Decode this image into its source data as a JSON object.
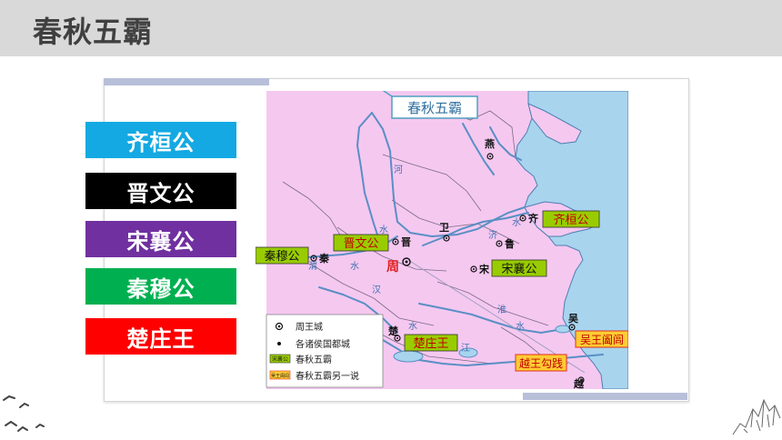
{
  "page_title": "春秋五霸",
  "hegemons": [
    {
      "label": "齐桓公",
      "color": "#14a9e2"
    },
    {
      "label": "晋文公",
      "color": "#000000"
    },
    {
      "label": "宋襄公",
      "color": "#7030a0"
    },
    {
      "label": "秦穆公",
      "color": "#00b050"
    },
    {
      "label": "楚庄王",
      "color": "#ff0000"
    }
  ],
  "map": {
    "title": "春秋五霸",
    "cities": {
      "yan": "燕",
      "qi": "齐",
      "lu": "鲁",
      "song": "宋",
      "wei": "卫",
      "jin": "晋",
      "qin": "秦",
      "zhou": "周",
      "chu": "楚",
      "wu": "吴",
      "yue": "越"
    },
    "hegemon_labels": {
      "qi": "齐桓公",
      "jin": "晋文公",
      "song": "宋襄公",
      "qin": "秦穆公",
      "chu": "楚庄王",
      "wu": "吴王阖闾",
      "yue": "越王勾践"
    },
    "rivers": {
      "he": "河",
      "shui1": "水",
      "ji": "济",
      "shui2": "水",
      "wei": "渭",
      "shui3": "水",
      "han": "汉",
      "shui4": "水",
      "huai": "淮",
      "shui5": "水",
      "jiang": "江"
    },
    "legend": [
      {
        "symbol": "capital-icon",
        "label": "周王城"
      },
      {
        "symbol": "city-icon",
        "label": "各诸侯国都城"
      },
      {
        "symbol": "hegemon-swatch",
        "swatch_text": "宋襄公",
        "label": "春秋五霸"
      },
      {
        "symbol": "alt-hegemon-swatch",
        "swatch_text": "吴王阖闾",
        "label": "春秋五霸另一说"
      }
    ],
    "colors": {
      "land": "#f5c8f0",
      "sea": "#a8d4ee",
      "hegemon_label_bg": "#99cc00",
      "hegemon_label_border": "#333333",
      "alt_label_bg": "#ffcc33",
      "alt_label_border": "#e0301e",
      "zhou_text": "#e02020"
    }
  }
}
